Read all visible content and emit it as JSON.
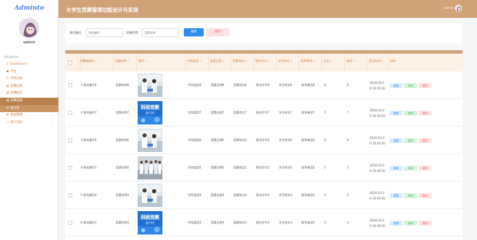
{
  "app": {
    "logo": "Adminto",
    "page_title": "大学生竞赛管理功能设计与实现",
    "top_user": "admin"
  },
  "sidebar": {
    "user": "admin",
    "section": "Navigation",
    "items": [
      {
        "label": "Dashboard",
        "icon": "home-icon",
        "state": ""
      },
      {
        "label": "学生",
        "icon": "user-icon",
        "state": ""
      },
      {
        "label": "学科分类",
        "icon": "pin-icon",
        "state": ""
      },
      {
        "label": "竞赛信息",
        "icon": "list-icon",
        "state": ""
      },
      {
        "label": "竞赛报名",
        "icon": "list-icon",
        "state": ""
      },
      {
        "label": "竞赛成绩",
        "icon": "list-icon",
        "state": "active"
      },
      {
        "label": "留言板",
        "icon": "message-icon",
        "state": "sub"
      },
      {
        "label": "系统管理",
        "icon": "grid-icon",
        "state": "",
        "chevron": true
      },
      {
        "label": "用户资料",
        "icon": "doc-icon",
        "state": "",
        "chevron": true
      }
    ]
  },
  "search": {
    "label1": "报名编号",
    "placeholder1": "报名编号",
    "label2": "竞赛名称",
    "placeholder2": "竞赛名称",
    "search_btn": "搜索",
    "delete_btn": "删除"
  },
  "table": {
    "headers": [
      "序号",
      "报名编号",
      "竞赛名称",
      "图片",
      "学科类型",
      "竞赛日期",
      "竞赛地点",
      "报名学号",
      "学生姓名",
      "联系电话",
      "名次",
      "成绩",
      "登记时间",
      "操作"
    ],
    "actions": {
      "view": "查看",
      "edit": "修改",
      "del": "删除"
    },
    "rows": [
      {
        "idx": "1",
        "reg": "报名编号8",
        "name": "竞赛名称8",
        "type": "学科类型8",
        "date": "竞赛日期8",
        "place": "竞赛地点8",
        "sid": "报名学号8",
        "stu": "学生姓名8",
        "tel": "联系电话8",
        "rank": "8",
        "score": "8",
        "time1": "2024-03-2",
        "time2": "6 10:45:02",
        "img": "lab"
      },
      {
        "idx": "2",
        "reg": "报名编号7",
        "name": "竞赛名称7",
        "type": "学科类型7",
        "date": "竞赛日期7",
        "place": "竞赛地点7",
        "sid": "报名学号7",
        "stu": "学生姓名7",
        "tel": "联系电话7",
        "rank": "7",
        "score": "7",
        "time1": "2024-03-2",
        "time2": "6 10:45:02",
        "img": "poster"
      },
      {
        "idx": "3",
        "reg": "报名编号6",
        "name": "竞赛名称6",
        "type": "学科类型6",
        "date": "竞赛日期6",
        "place": "竞赛地点6",
        "sid": "报名学号6",
        "stu": "学生姓名6",
        "tel": "联系电话6",
        "rank": "6",
        "score": "6",
        "time1": "2024-03-2",
        "time2": "6 10:45:02",
        "img": "lab"
      },
      {
        "idx": "4",
        "reg": "报名编号5",
        "name": "竞赛名称5",
        "type": "学科类型5",
        "date": "竞赛日期5",
        "place": "竞赛地点5",
        "sid": "报名学号5",
        "stu": "学生姓名5",
        "tel": "联系电话5",
        "rank": "5",
        "score": "5",
        "time1": "2024-03-2",
        "time2": "6 10:45:02",
        "img": "group"
      },
      {
        "idx": "5",
        "reg": "报名编号4",
        "name": "竞赛名称4",
        "type": "学科类型4",
        "date": "竞赛日期4",
        "place": "竞赛地点4",
        "sid": "报名学号4",
        "stu": "学生姓名4",
        "tel": "联系电话4",
        "rank": "4",
        "score": "4",
        "time1": "2024-03-2",
        "time2": "6 10:45:02",
        "img": "lab"
      },
      {
        "idx": "6",
        "reg": "报名编号3",
        "name": "竞赛名称3",
        "type": "学科类型3",
        "date": "竞赛日期3",
        "place": "竞赛地点3",
        "sid": "报名学号3",
        "stu": "学生姓名3",
        "tel": "联系电话3",
        "rank": "3",
        "score": "3",
        "time1": "2024-03-2",
        "time2": "6 10:45:02",
        "img": "poster"
      }
    ],
    "poster_text1": "科技竞赛",
    "poster_text2": "进行时"
  },
  "colors": {
    "accent": "#cfa277",
    "active": "#b8824e",
    "nav_text": "#d07a3a",
    "primary": "#2d8cf0"
  }
}
